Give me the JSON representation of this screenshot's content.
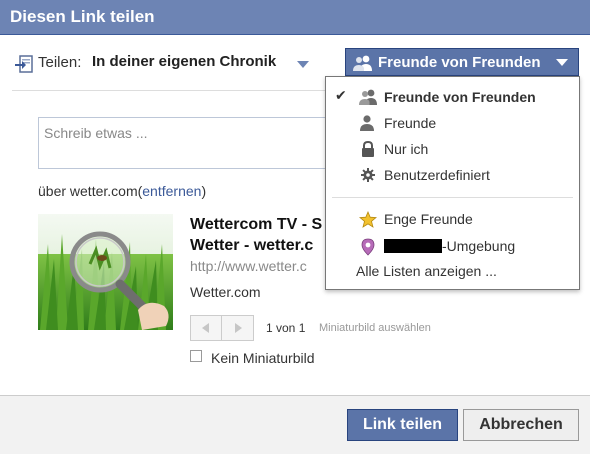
{
  "dialog": {
    "title": "Diesen Link teilen"
  },
  "share": {
    "label": "Teilen:",
    "target": "In deiner eigenen Chronik",
    "icon": "share-arrow-icon"
  },
  "audience": {
    "selected": "Freunde von Freunden",
    "icon": "friends-icon",
    "button_color": "#5b74a8"
  },
  "compose": {
    "placeholder": "Schreib etwas ..."
  },
  "attachment": {
    "source_prefix": "über wetter.com(",
    "remove_label": "entfernen",
    "source_suffix": ")",
    "title_line1": "Wettercom TV - S",
    "title_line2": "Wetter - wetter.c",
    "url": "http://www.wetter.c",
    "description": "Wetter.com",
    "thumbnail_icon": "magnifying-glass-grass-image",
    "page_count": "1 von 1",
    "pick_thumbnail": "Miniaturbild auswählen",
    "no_thumbnail_label": "Kein Miniaturbild",
    "no_thumbnail_checked": false
  },
  "dropdown": {
    "items": [
      {
        "label": "Freunde von Freunden",
        "icon": "friends-icon",
        "checked": true
      },
      {
        "label": "Freunde",
        "icon": "friend-icon",
        "checked": false
      },
      {
        "label": "Nur ich",
        "icon": "lock-icon",
        "checked": false
      },
      {
        "label": "Benutzerdefiniert",
        "icon": "gear-icon",
        "checked": false
      },
      {
        "label": "Enge Freunde",
        "icon": "star-icon",
        "checked": false
      },
      {
        "label": "-Umgebung",
        "icon": "location-pin-icon",
        "checked": false,
        "redacted_prefix": true
      }
    ],
    "show_all": "Alle Listen anzeigen ..."
  },
  "footer": {
    "share_button": "Link teilen",
    "cancel_button": "Abbrechen"
  },
  "colors": {
    "header": "#6d84b4",
    "link": "#3b5998",
    "primary": "#5b74a8"
  }
}
